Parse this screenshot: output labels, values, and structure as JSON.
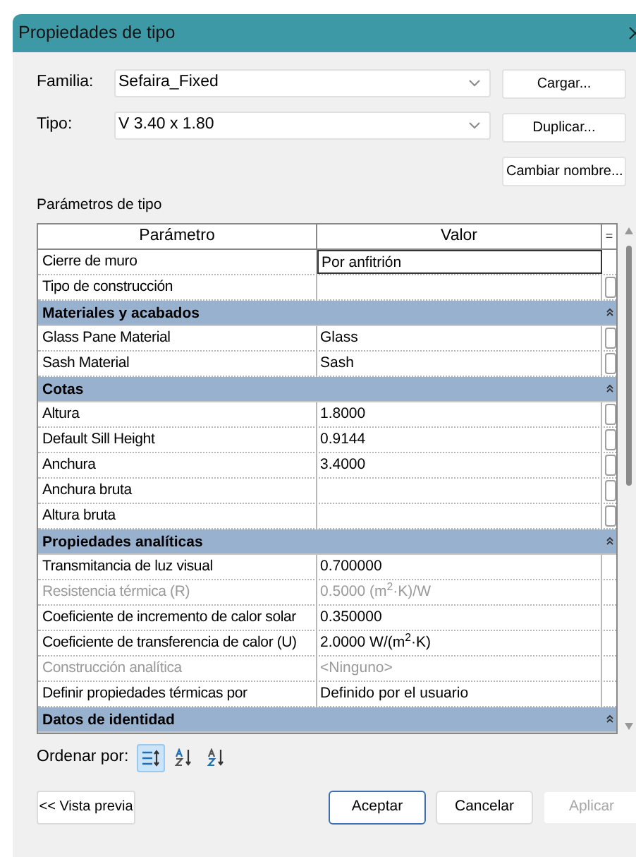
{
  "window": {
    "title": "Propiedades de tipo"
  },
  "family": {
    "label": "Familia:",
    "value": "Sefaira_Fixed"
  },
  "type": {
    "label": "Tipo:",
    "value": "V 3.40 x 1.80"
  },
  "side_buttons": [
    "Cargar...",
    "Duplicar...",
    "Cambiar nombre..."
  ],
  "section_label": "Parámetros de tipo",
  "table": {
    "columns": [
      "Parámetro",
      "Valor",
      "="
    ],
    "rows": [
      {
        "kind": "param",
        "name": "Cierre de muro",
        "value": "Por anfitrión",
        "selected": true,
        "disabled": false,
        "formula_button": false
      },
      {
        "kind": "param",
        "name": "Tipo de construcción",
        "value": "",
        "selected": false,
        "disabled": false,
        "formula_button": true
      },
      {
        "kind": "group",
        "name": "Materiales y acabados",
        "expanded": true
      },
      {
        "kind": "param",
        "name": "Glass Pane Material",
        "value": "Glass",
        "selected": false,
        "disabled": false,
        "formula_button": true
      },
      {
        "kind": "param",
        "name": "Sash Material",
        "value": "Sash",
        "selected": false,
        "disabled": false,
        "formula_button": true
      },
      {
        "kind": "group",
        "name": "Cotas",
        "expanded": true
      },
      {
        "kind": "param",
        "name": "Altura",
        "value": "1.8000",
        "selected": false,
        "disabled": false,
        "formula_button": true
      },
      {
        "kind": "param",
        "name": "Default Sill Height",
        "value": "0.9144",
        "selected": false,
        "disabled": false,
        "formula_button": true
      },
      {
        "kind": "param",
        "name": "Anchura",
        "value": "3.4000",
        "selected": false,
        "disabled": false,
        "formula_button": true
      },
      {
        "kind": "param",
        "name": "Anchura bruta",
        "value": "",
        "selected": false,
        "disabled": false,
        "formula_button": true
      },
      {
        "kind": "param",
        "name": "Altura bruta",
        "value": "",
        "selected": false,
        "disabled": false,
        "formula_button": true
      },
      {
        "kind": "group",
        "name": "Propiedades analíticas",
        "expanded": true
      },
      {
        "kind": "param",
        "name": "Transmitancia de luz visual",
        "value": "0.700000",
        "selected": false,
        "disabled": false,
        "formula_button": false
      },
      {
        "kind": "param",
        "name": "Resistencia térmica (R)",
        "value": "0.5000 (m$^{2}$·K)/W",
        "selected": false,
        "disabled": true,
        "formula_button": false
      },
      {
        "kind": "param",
        "name": "Coeficiente de incremento de calor solar",
        "value": "0.350000",
        "selected": false,
        "disabled": false,
        "formula_button": false
      },
      {
        "kind": "param",
        "name": "Coeficiente de transferencia de calor (U)",
        "value": "2.0000 W/(m$^{2}$·K)",
        "selected": false,
        "disabled": false,
        "formula_button": false
      },
      {
        "kind": "param",
        "name": "Construcción analítica",
        "value": "<Ninguno>",
        "selected": false,
        "disabled": true,
        "formula_button": false
      },
      {
        "kind": "param",
        "name": "Definir propiedades térmicas por",
        "value": "Definido por el usuario",
        "selected": false,
        "disabled": false,
        "formula_button": false
      },
      {
        "kind": "group",
        "name": "Datos de identidad",
        "expanded": true
      }
    ]
  },
  "sort": {
    "label": "Ordenar por:",
    "options": [
      {
        "kind": "group",
        "selected": true
      },
      {
        "kind": "az",
        "selected": false
      },
      {
        "kind": "za",
        "selected": false
      }
    ]
  },
  "preview_button": "<< Vista previa",
  "footer_buttons": [
    {
      "label": "Aceptar",
      "default": true,
      "disabled": false
    },
    {
      "label": "Cancelar",
      "default": false,
      "disabled": false
    },
    {
      "label": "Aplicar",
      "default": false,
      "disabled": true
    }
  ]
}
